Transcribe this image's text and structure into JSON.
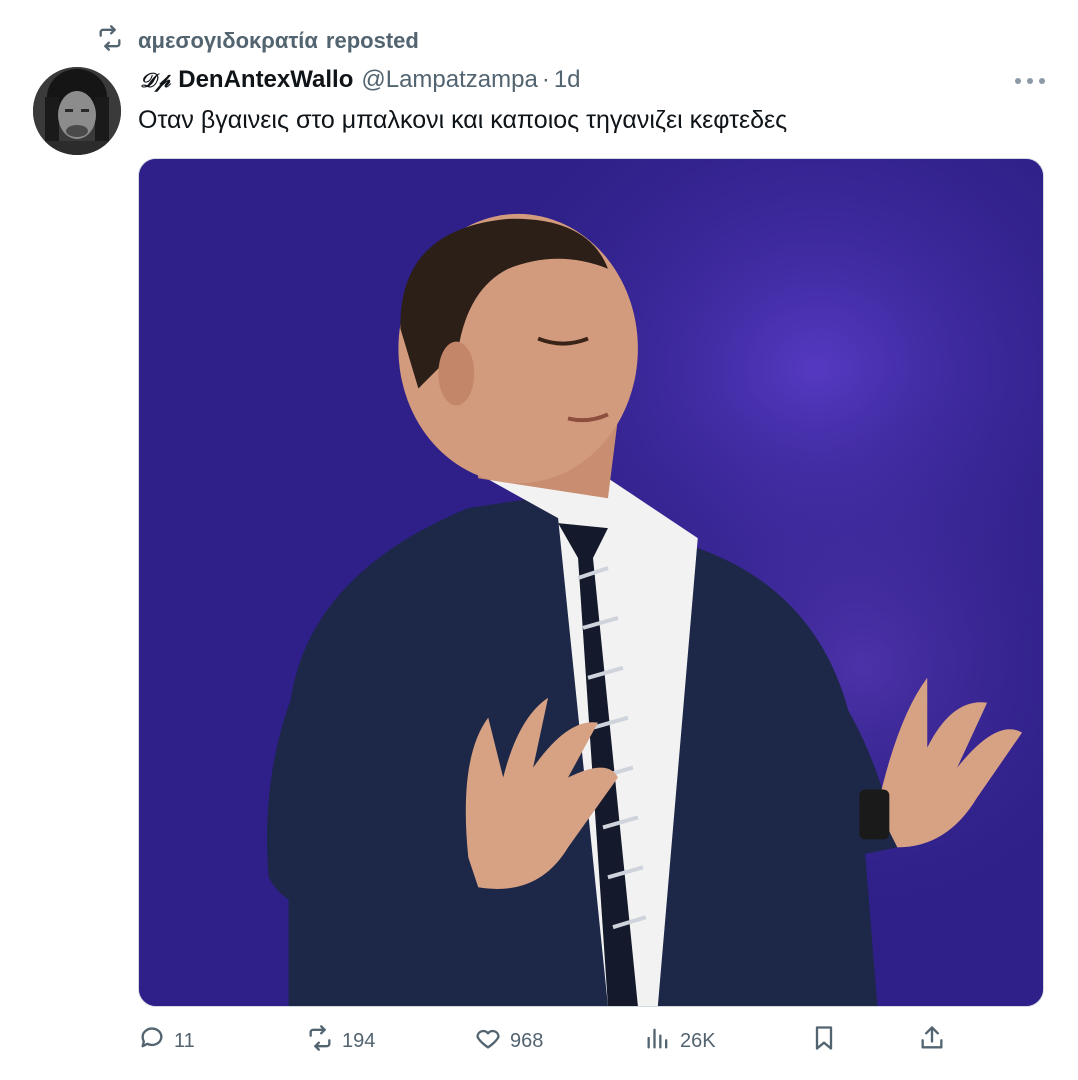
{
  "repost": {
    "icon": "repost-icon",
    "reposter": "αμεσογιδοκρατία",
    "label": "reposted"
  },
  "author": {
    "avatar_icon": "user-avatar",
    "logo_glyph": "𝒟𝓅",
    "display_name": "DenAntexWallo",
    "handle": "@Lampatzampa",
    "separator": "·",
    "time": "1d"
  },
  "more_icon": "more-horizontal-icon",
  "tweet": {
    "text": "Οταν βγαινεις στο μπαλκονι και καποιος τηγανιζει κεφτεδες"
  },
  "media": {
    "type": "photo",
    "subject": "man in navy suit with eyes closed and arms outstretched on stage with purple background"
  },
  "actions": {
    "reply": {
      "icon": "reply-icon",
      "count": "11"
    },
    "repost": {
      "icon": "repost-icon",
      "count": "194"
    },
    "like": {
      "icon": "heart-icon",
      "count": "968"
    },
    "views": {
      "icon": "views-chart-icon",
      "count": "26K"
    },
    "bookmark": {
      "icon": "bookmark-icon"
    },
    "share": {
      "icon": "share-icon"
    }
  },
  "colors": {
    "text_primary": "#0f1419",
    "text_secondary": "#536471",
    "media_background": "#352596"
  }
}
